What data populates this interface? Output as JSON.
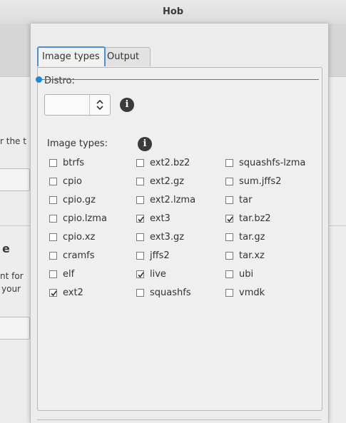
{
  "window": {
    "title": "Hob"
  },
  "background": {
    "text1": "r the t",
    "heading_fragment": "e",
    "text2": "nt for",
    "text3": "your"
  },
  "tabs": [
    {
      "label": "Image types",
      "active": true
    },
    {
      "label": "Output",
      "active": false
    }
  ],
  "distro": {
    "label": "Distro:",
    "value": ""
  },
  "image_types": {
    "label": "Image types:",
    "items": [
      {
        "label": "btrfs",
        "checked": false
      },
      {
        "label": "cpio",
        "checked": false
      },
      {
        "label": "cpio.gz",
        "checked": false
      },
      {
        "label": "cpio.lzma",
        "checked": false
      },
      {
        "label": "cpio.xz",
        "checked": false
      },
      {
        "label": "cramfs",
        "checked": false
      },
      {
        "label": "elf",
        "checked": false
      },
      {
        "label": "ext2",
        "checked": true
      },
      {
        "label": "ext2.bz2",
        "checked": false
      },
      {
        "label": "ext2.gz",
        "checked": false
      },
      {
        "label": "ext2.lzma",
        "checked": false
      },
      {
        "label": "ext3",
        "checked": true
      },
      {
        "label": "ext3.gz",
        "checked": false
      },
      {
        "label": "jffs2",
        "checked": false
      },
      {
        "label": "live",
        "checked": true
      },
      {
        "label": "squashfs",
        "checked": false
      },
      {
        "label": "squashfs-lzma",
        "checked": false
      },
      {
        "label": "sum.jffs2",
        "checked": false
      },
      {
        "label": "tar",
        "checked": false
      },
      {
        "label": "tar.bz2",
        "checked": true
      },
      {
        "label": "tar.gz",
        "checked": false
      },
      {
        "label": "tar.xz",
        "checked": false
      },
      {
        "label": "ubi",
        "checked": false
      },
      {
        "label": "vmdk",
        "checked": false
      }
    ]
  },
  "icons": {
    "info": "info-icon",
    "spin": "spin-arrows-icon",
    "check": "checkmark-icon"
  },
  "colors": {
    "accent": "#4a90d9",
    "overlay_line": "#1e88d8"
  }
}
